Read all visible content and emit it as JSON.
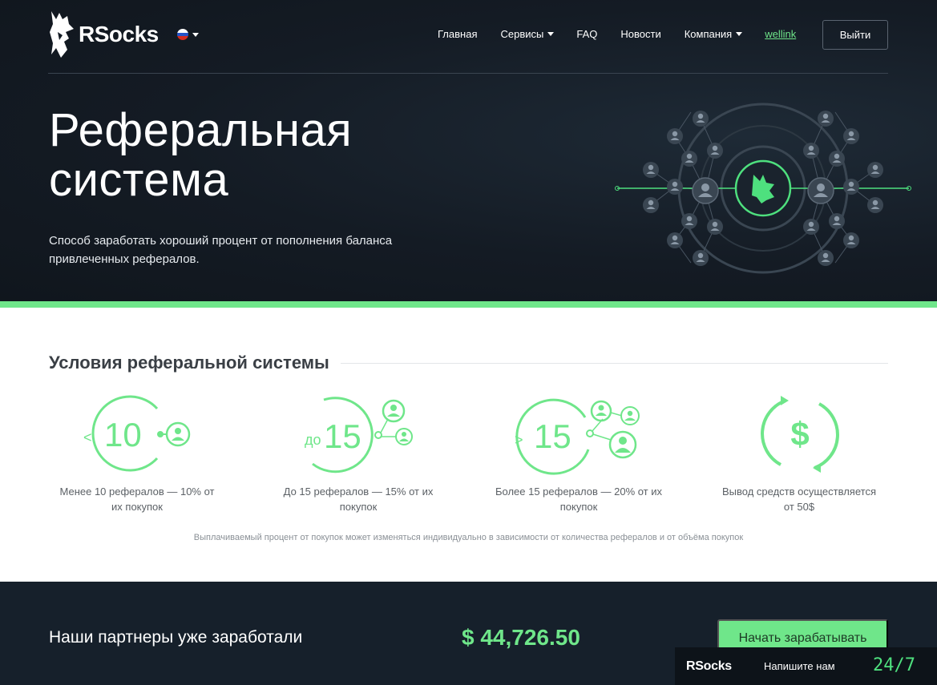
{
  "brand": {
    "name": "RSocks"
  },
  "nav": {
    "home": "Главная",
    "services": "Сервисы",
    "faq": "FAQ",
    "news": "Новости",
    "company": "Компания",
    "user": "wellink",
    "logout": "Выйти"
  },
  "hero": {
    "title_line1": "Реферальная",
    "title_line2": "система",
    "subtitle": "Способ заработать хороший процент от пополнения баланса привлеченных рефералов."
  },
  "conditions": {
    "title": "Условия реферальной системы",
    "items": [
      {
        "prefix": "<",
        "number": "10",
        "caption_line1": "Менее 10 рефералов — 10% от",
        "caption_line2": "их покупок"
      },
      {
        "prefix": "до",
        "number": "15",
        "caption_line1": "До 15 рефералов — 15% от их",
        "caption_line2": "покупок"
      },
      {
        "prefix": ">",
        "number": "15",
        "caption_line1": "Более 15 рефералов — 20% от их",
        "caption_line2": "покупок"
      },
      {
        "prefix": "",
        "number": "$",
        "caption_line1": "Вывод средств осуществляется",
        "caption_line2": "от 50$"
      }
    ],
    "note": "Выплачиваемый процент от покупок может изменяться индивидуально в зависимости от количества рефералов и от объёма покупок"
  },
  "earnings": {
    "label": "Наши партнеры уже заработали",
    "amount": "$ 44,726.50",
    "button": "Начать зарабатывать"
  },
  "chat": {
    "brand": "RSocks",
    "label": "Напишите нам",
    "hours": "24/7"
  },
  "colors": {
    "accent": "#6fe68a",
    "dark_bg": "#141b24",
    "icon_gray": "#4a5663"
  },
  "icons": [
    "wolf-logo-icon",
    "russia-flag-icon",
    "chevron-down-icon",
    "user-icon",
    "dollar-refresh-icon"
  ]
}
